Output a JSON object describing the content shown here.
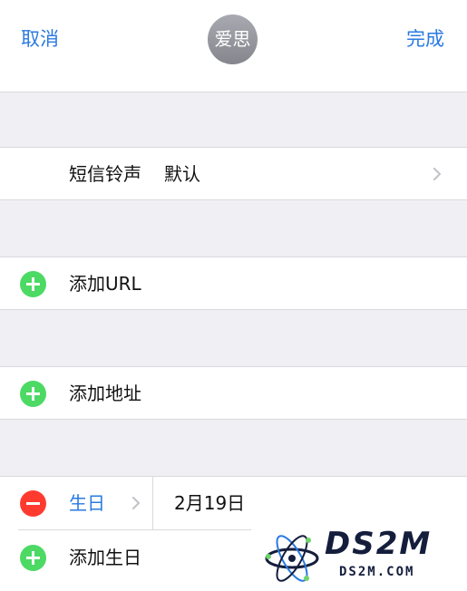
{
  "header": {
    "cancel_label": "取消",
    "done_label": "完成",
    "avatar_text": "爱思"
  },
  "rows": {
    "text_tone": {
      "label": "短信铃声",
      "value": "默认"
    },
    "add_url": {
      "label": "添加URL"
    },
    "add_address": {
      "label": "添加地址"
    },
    "birthday": {
      "label": "生日",
      "value": "2月19日"
    },
    "add_birthday": {
      "label": "添加生日"
    }
  },
  "watermark": {
    "title": "DS2M",
    "subtitle": "DS2M.COM"
  },
  "colors": {
    "accent_blue": "#2a7ae2",
    "add_green": "#4cd964",
    "remove_red": "#ff3b30",
    "group_bg": "#efeff4"
  }
}
